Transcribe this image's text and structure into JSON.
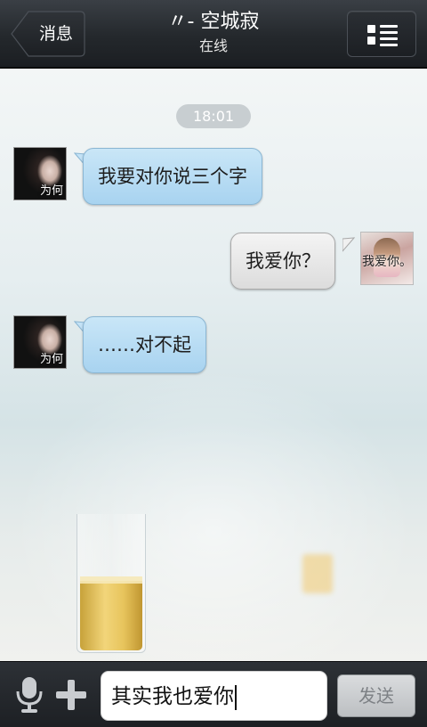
{
  "header": {
    "back_label": "消息",
    "title": "〃- 空城寂",
    "status": "在线"
  },
  "chat": {
    "timestamp": "18:01",
    "messages": [
      {
        "side": "left",
        "text": "我要对你说三个字",
        "avatar_caption": "为何"
      },
      {
        "side": "right",
        "text": "我爱你？",
        "avatar_caption": "我爱你。"
      },
      {
        "side": "left",
        "text": "……对不起",
        "avatar_caption": "为何"
      }
    ]
  },
  "composer": {
    "input_value": "其实我也爱你",
    "send_label": "发送"
  },
  "icons": {
    "back": "chevron-left-icon",
    "menu": "list-menu-icon",
    "mic": "microphone-icon",
    "plus": "plus-icon"
  },
  "colors": {
    "topbar": "#24282c",
    "bubble_incoming": "#b8dcf4",
    "bubble_outgoing": "#e6e6e6",
    "send_text": "#7d8185"
  }
}
